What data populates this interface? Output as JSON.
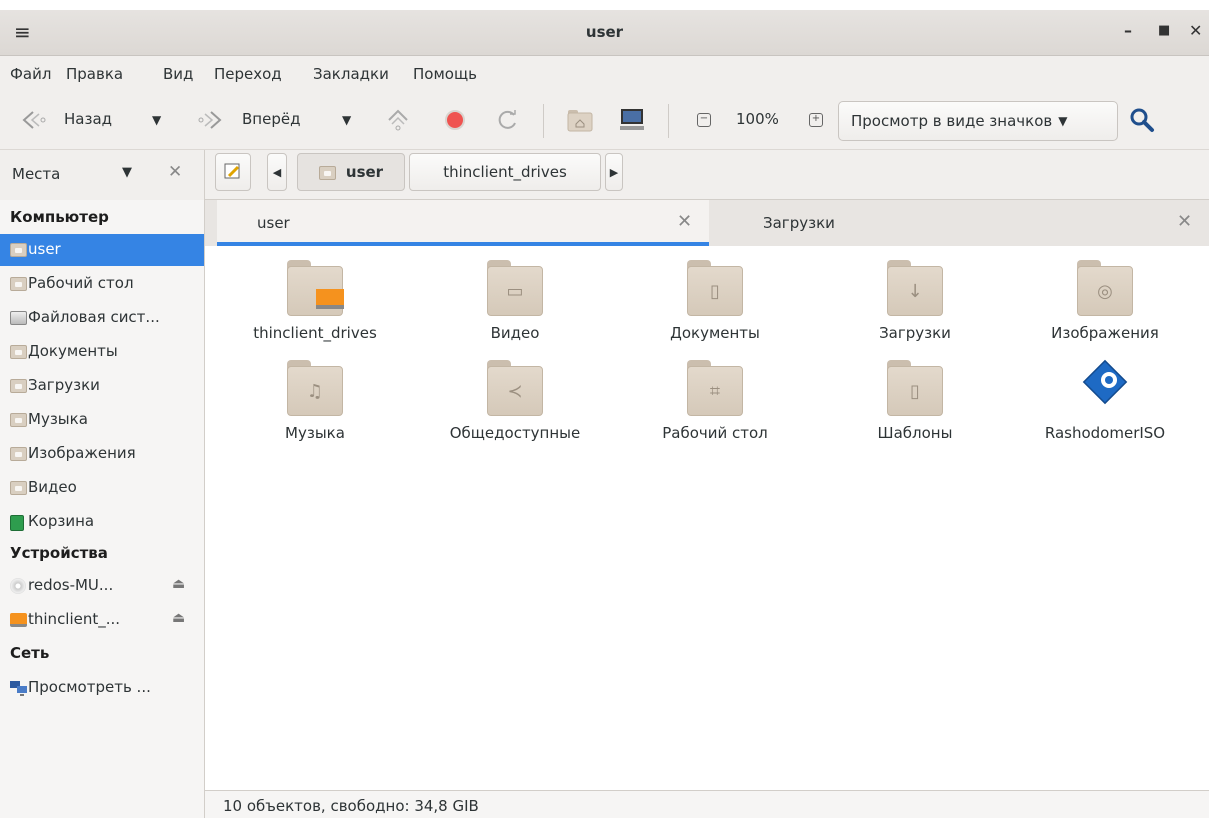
{
  "window": {
    "title": "user",
    "menu_icon": "hamburger-icon"
  },
  "menubar": [
    "Файл",
    "Правка",
    "Вид",
    "Переход",
    "Закладки",
    "Помощь"
  ],
  "toolbar": {
    "back_label": "Назад",
    "forward_label": "Вперёд",
    "zoom": "100%",
    "view_mode": "Просмотр в виде значков"
  },
  "places": {
    "label": "Места",
    "sections": {
      "computer": "Компьютер",
      "devices": "Устройства",
      "network": "Сеть"
    },
    "computer_items": [
      "user",
      "Рабочий стол",
      "Файловая сист...",
      "Документы",
      "Загрузки",
      "Музыка",
      "Изображения",
      "Видео",
      "Корзина"
    ],
    "device_items": [
      "redos-MU...",
      "thinclient_..."
    ],
    "network_items": [
      "Просмотреть ..."
    ]
  },
  "pathbar": {
    "crumbs": [
      "user",
      "thinclient_drives"
    ]
  },
  "tabs": [
    "user",
    "Загрузки"
  ],
  "files": [
    {
      "name": "thinclient_drives",
      "icon": "drive-folder-icon"
    },
    {
      "name": "Видео",
      "icon": "video-folder-icon"
    },
    {
      "name": "Документы",
      "icon": "documents-folder-icon"
    },
    {
      "name": "Загрузки",
      "icon": "downloads-folder-icon"
    },
    {
      "name": "Изображения",
      "icon": "pictures-folder-icon"
    },
    {
      "name": "Музыка",
      "icon": "music-folder-icon"
    },
    {
      "name": "Общедоступные",
      "icon": "public-folder-icon"
    },
    {
      "name": "Рабочий стол",
      "icon": "desktop-folder-icon"
    },
    {
      "name": "Шаблоны",
      "icon": "templates-folder-icon"
    },
    {
      "name": "RashodomerISO",
      "icon": "app-gear-icon"
    }
  ],
  "status": "10 объектов, свободно: 34,8 GIB",
  "colors": {
    "accent": "#3584e4",
    "folder": "#d9cfc1"
  }
}
